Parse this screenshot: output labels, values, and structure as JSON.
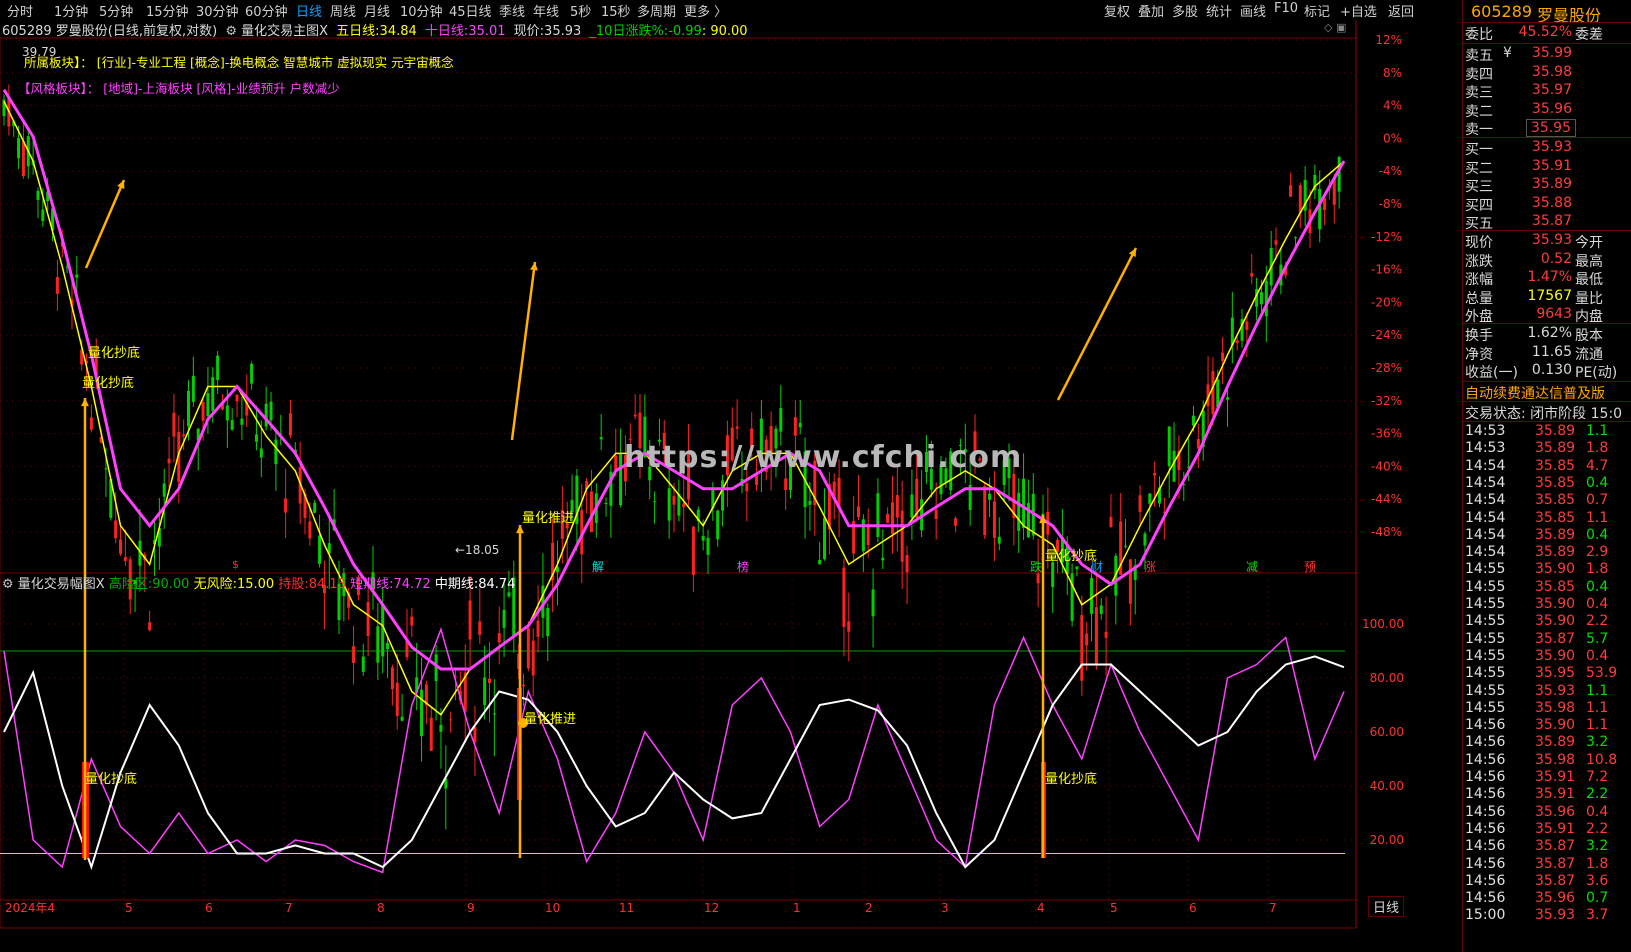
{
  "toolbar": {
    "periods": [
      "分时",
      "1分钟",
      "5分钟",
      "15分钟",
      "30分钟",
      "60分钟",
      "日线",
      "周线",
      "月线",
      "10分钟",
      "45日线",
      "季线",
      "年线",
      "5秒",
      "15秒",
      "多周期",
      "更多 〉"
    ],
    "active_period": "日线",
    "right_buttons": [
      "复权",
      "叠加",
      "多股",
      "统计",
      "画线",
      "F10",
      "标记",
      "+自选",
      "返回"
    ]
  },
  "stock": {
    "code": "605289",
    "name": "罗曼股份",
    "title_line": "605289 罗曼股份(日线,前复权,对数)"
  },
  "main_indicator": {
    "name": "量化交易主图X",
    "ma5_label": "五日线:",
    "ma5_value": "34.84",
    "ma5_color": "#ffff00",
    "ma10_label": "十日线:",
    "ma10_value": "35.01",
    "ma10_color": "#ff40ff",
    "price_label": "现价:",
    "price_value": "35.93",
    "change10_label": "_10日涨跌%:",
    "change10_value": "-0.99",
    "change10_extra": ": 90.00",
    "high_marker": "39.79",
    "low_marker": "←18.05",
    "sector_line1": "所属板块】：  [行业]-专业工程 [概念]-换电概念 智慧城市 虚拟现实 元宇宙概念",
    "sector_line2": "【风格板块】：  [地域]-上海板块 [风格]-业绩预升 户数减少",
    "annotations": [
      "量化抄底",
      "量化抄底",
      "量化推进",
      "量化抄底"
    ],
    "event_marks": [
      "$",
      "解",
      "榜",
      "跌",
      "财",
      "涨",
      "减",
      "预"
    ],
    "watermark": "https://www.cfchi.com"
  },
  "sub_indicator": {
    "name": "量化交易幅图X",
    "high_risk_label": "高险区:",
    "high_risk_value": "90.00",
    "high_risk_color": "#00b000",
    "no_risk_label": "无风险:",
    "no_risk_value": "15.00",
    "no_risk_color": "#ffff00",
    "hold_label": "持股:",
    "hold_value": "84.13",
    "hold_color": "#ff3030",
    "short_label": "短期线:",
    "short_value": "74.72",
    "short_color": "#ff40ff",
    "mid_label": "中期线:",
    "mid_value": "84.74",
    "mid_color": "#ffffff",
    "annotations": [
      "量化抄底",
      "量化推进",
      "量化抄底"
    ]
  },
  "chart_data": {
    "type": "line",
    "price_axis_pct": [
      "12%",
      "8%",
      "4%",
      "0%",
      "-4%",
      "-8%",
      "-12%",
      "-16%",
      "-20%",
      "-24%",
      "-28%",
      "-32%",
      "-36%",
      "-40%",
      "-44%",
      "-48%"
    ],
    "sub_axis": [
      "100.00",
      "80.00",
      "60.00",
      "40.00",
      "20.00"
    ],
    "x_labels": [
      "2024年4",
      "5",
      "6",
      "7",
      "8",
      "9",
      "10",
      "11",
      "12",
      "1",
      "2",
      "3",
      "4",
      "5",
      "6",
      "7"
    ],
    "series": [
      {
        "name": "五日线",
        "values": [
          37.5,
          35,
          31,
          27,
          23,
          22,
          25,
          27,
          27,
          25.5,
          24.5,
          22.5,
          21,
          20.5,
          19,
          18.5,
          19.5,
          20,
          20.5,
          22,
          24,
          25,
          25,
          24,
          23,
          24.5,
          25,
          25,
          23.5,
          22,
          22.5,
          23,
          24,
          24.5,
          24,
          23,
          22.5,
          21,
          21.5,
          23,
          24.5,
          26,
          28,
          30,
          32,
          34,
          35
        ]
      },
      {
        "name": "十日线",
        "values": [
          38,
          36,
          32,
          28,
          24,
          23,
          24,
          26,
          27,
          26,
          25,
          23.5,
          22,
          21,
          20,
          19.5,
          19.5,
          20,
          20.5,
          21.5,
          23,
          24.5,
          25,
          24.5,
          24,
          24,
          24.5,
          25,
          24.5,
          23,
          23,
          23,
          23.5,
          24,
          24,
          23.5,
          23,
          22,
          21.5,
          22,
          23.5,
          25,
          27,
          29,
          31,
          33,
          35
        ]
      },
      {
        "name": "短期线",
        "values": [
          90,
          20,
          10,
          50,
          25,
          15,
          30,
          15,
          20,
          12,
          20,
          18,
          12,
          8,
          70,
          98,
          60,
          30,
          75,
          50,
          12,
          30,
          60,
          45,
          20,
          70,
          80,
          60,
          25,
          35,
          70,
          45,
          20,
          10,
          70,
          95,
          70,
          50,
          85,
          60,
          40,
          20,
          80,
          85,
          95,
          50,
          75
        ]
      },
      {
        "name": "中期线",
        "values": [
          60,
          82,
          40,
          10,
          45,
          70,
          55,
          30,
          15,
          15,
          18,
          15,
          15,
          10,
          20,
          40,
          60,
          75,
          72,
          60,
          40,
          25,
          30,
          45,
          35,
          28,
          30,
          50,
          70,
          72,
          68,
          55,
          30,
          10,
          20,
          45,
          70,
          85,
          85,
          75,
          65,
          55,
          60,
          75,
          85,
          88,
          84
        ]
      }
    ],
    "high_risk": 90,
    "no_risk": 15
  },
  "right_panel": {
    "header_code": "605289",
    "header_name": "罗曼股份",
    "webi_label": "委比",
    "webi_value": "45.52%",
    "wecha_label": "委差",
    "asks": [
      {
        "label": "卖五",
        "value": "35.99",
        "flag": "¥"
      },
      {
        "label": "卖四",
        "value": "35.98"
      },
      {
        "label": "卖三",
        "value": "35.97"
      },
      {
        "label": "卖二",
        "value": "35.96"
      },
      {
        "label": "卖一",
        "value": "35.95"
      }
    ],
    "bids": [
      {
        "label": "买一",
        "value": "35.93"
      },
      {
        "label": "买二",
        "value": "35.91"
      },
      {
        "label": "买三",
        "value": "35.89"
      },
      {
        "label": "买四",
        "value": "35.88"
      },
      {
        "label": "买五",
        "value": "35.87"
      }
    ],
    "stats": [
      {
        "l1": "现价",
        "v1": "35.93",
        "l2": "今开"
      },
      {
        "l1": "涨跌",
        "v1": "0.52",
        "l2": "最高"
      },
      {
        "l1": "涨幅",
        "v1": "1.47%",
        "l2": "最低"
      },
      {
        "l1": "总量",
        "v1": "17567",
        "l2": "量比",
        "vcolor": "#ffff00"
      },
      {
        "l1": "外盘",
        "v1": "9643",
        "l2": "内盘"
      }
    ],
    "stats2": [
      {
        "l1": "换手",
        "v1": "1.62%",
        "l2": "股本"
      },
      {
        "l1": "净资",
        "v1": "11.65",
        "l2": "流通"
      },
      {
        "l1": "收益(一)",
        "v1": "0.130",
        "l2": "PE(动)"
      }
    ],
    "promo": "自动续费通达信普及版",
    "trade_status_label": "交易状态:",
    "trade_status_value": "闭市阶段",
    "trade_status_time": "15:0",
    "ticks": [
      [
        "14:53",
        "35.89",
        "1.1"
      ],
      [
        "14:53",
        "35.89",
        "1.8"
      ],
      [
        "14:54",
        "35.85",
        "4.7"
      ],
      [
        "14:54",
        "35.85",
        "0.4"
      ],
      [
        "14:54",
        "35.85",
        "0.7"
      ],
      [
        "14:54",
        "35.85",
        "1.1"
      ],
      [
        "14:54",
        "35.89",
        "0.4"
      ],
      [
        "14:54",
        "35.89",
        "2.9"
      ],
      [
        "14:55",
        "35.90",
        "1.8"
      ],
      [
        "14:55",
        "35.85",
        "0.4"
      ],
      [
        "14:55",
        "35.90",
        "0.4"
      ],
      [
        "14:55",
        "35.90",
        "2.2"
      ],
      [
        "14:55",
        "35.87",
        "5.7"
      ],
      [
        "14:55",
        "35.90",
        "0.4"
      ],
      [
        "14:55",
        "35.95",
        "53.9"
      ],
      [
        "14:55",
        "35.93",
        "1.1"
      ],
      [
        "14:55",
        "35.98",
        "1.1"
      ],
      [
        "14:56",
        "35.90",
        "1.1"
      ],
      [
        "14:56",
        "35.89",
        "3.2"
      ],
      [
        "14:56",
        "35.98",
        "10.8"
      ],
      [
        "14:56",
        "35.91",
        "7.2"
      ],
      [
        "14:56",
        "35.91",
        "2.2"
      ],
      [
        "14:56",
        "35.96",
        "0.4"
      ],
      [
        "14:56",
        "35.91",
        "2.2"
      ],
      [
        "14:56",
        "35.87",
        "3.2"
      ],
      [
        "14:56",
        "35.87",
        "1.8"
      ],
      [
        "14:56",
        "35.87",
        "3.6"
      ],
      [
        "14:56",
        "35.96",
        "0.7"
      ],
      [
        "15:00",
        "35.93",
        "3.7"
      ]
    ],
    "period_tab": "日线"
  }
}
